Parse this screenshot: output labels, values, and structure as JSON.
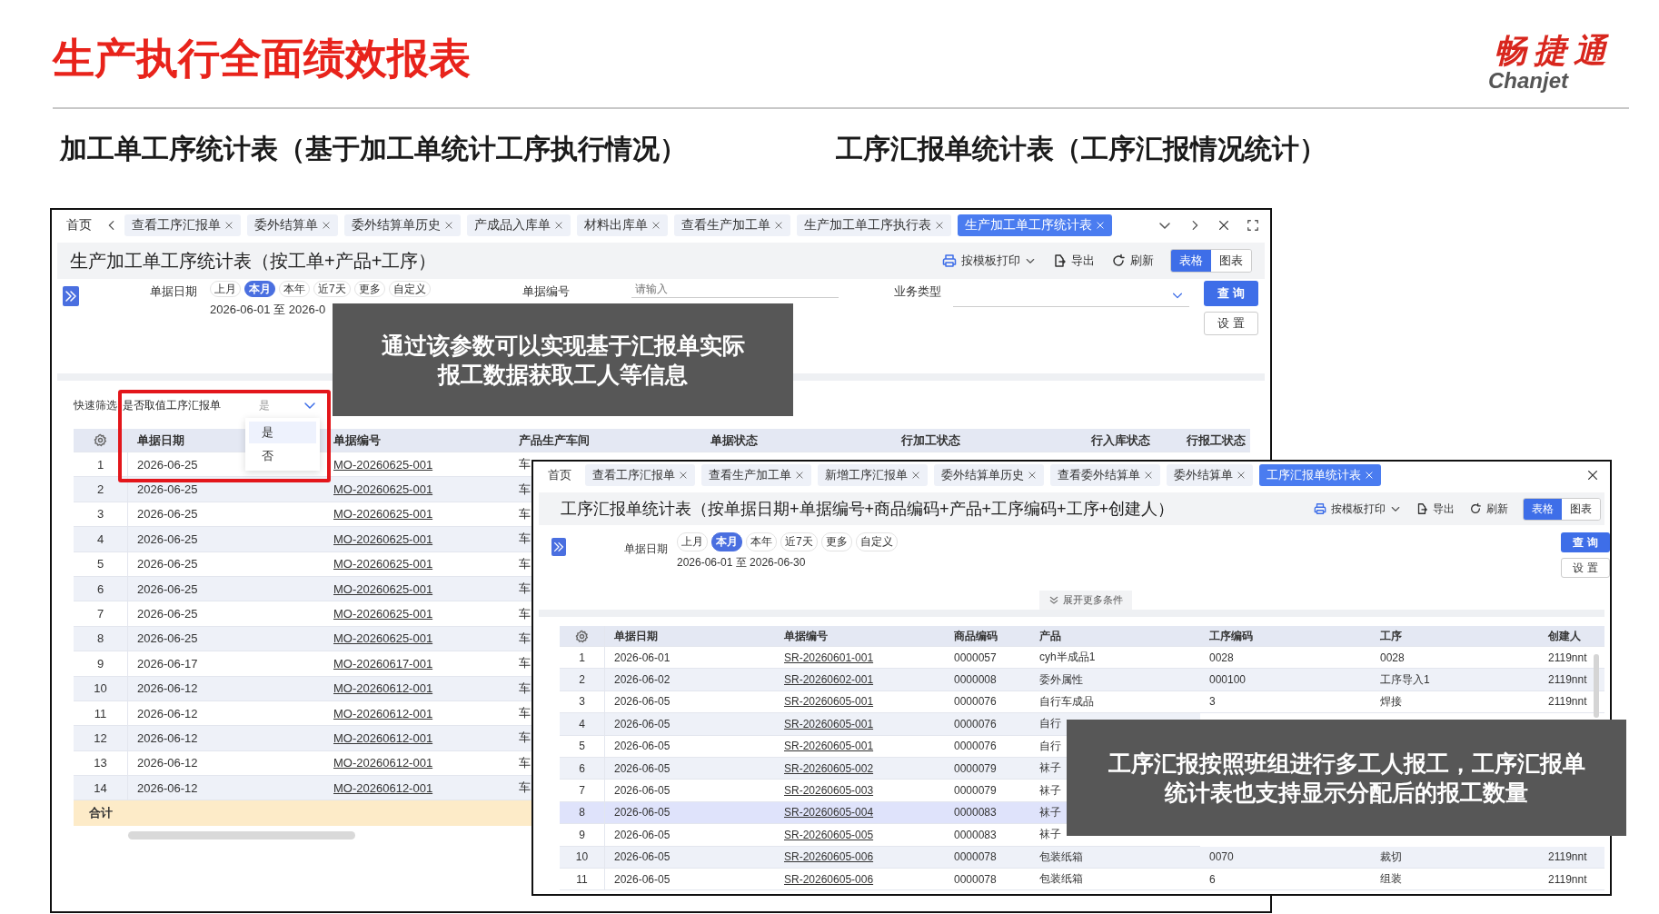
{
  "slide": {
    "title": "生产执行全面绩效报表",
    "logo": {
      "mark": "畅捷通",
      "wordmark": "Chanjet"
    }
  },
  "sections": [
    {
      "heading": "加工单工序统计表（基于加工单统计工序执行情况）"
    },
    {
      "heading": "工序汇报单统计表（工序汇报情况统计）"
    }
  ],
  "window_1": {
    "tabs": [
      {
        "label": "首页",
        "closable": false,
        "selected": false
      },
      {
        "label": "查看工序汇报单",
        "closable": true,
        "selected": false
      },
      {
        "label": "委外结算单",
        "closable": true,
        "selected": false
      },
      {
        "label": "委外结算单历史",
        "closable": true,
        "selected": false
      },
      {
        "label": "产成品入库单",
        "closable": true,
        "selected": false
      },
      {
        "label": "材料出库单",
        "closable": true,
        "selected": false
      },
      {
        "label": "查看生产加工单",
        "closable": true,
        "selected": false
      },
      {
        "label": "生产加工单工序执行表",
        "closable": true,
        "selected": false
      },
      {
        "label": "生产加工单工序统计表",
        "closable": true,
        "selected": true
      }
    ],
    "title": "生产加工单工序统计表（按工单+产品+工序）",
    "toolbar": {
      "print": "按模板打印",
      "export": "导出",
      "refresh": "刷新",
      "views": [
        {
          "label": "表格",
          "selected": true
        },
        {
          "label": "图表",
          "selected": false
        }
      ]
    },
    "filters": {
      "date_label": "单据日期",
      "presets": [
        {
          "label": "上月",
          "selected": false
        },
        {
          "label": "本月",
          "selected": true
        },
        {
          "label": "本年",
          "selected": false
        },
        {
          "label": "近7天",
          "selected": false
        },
        {
          "label": "更多",
          "selected": false
        },
        {
          "label": "自定义",
          "selected": false
        }
      ],
      "date_range": "2026-06-01 至 2026-0",
      "code_label": "单据编号",
      "code_placeholder": "请输入",
      "type_label": "业务类型",
      "query": "查 询",
      "settings": "设 置"
    },
    "quick_filter": {
      "label": "快速筛选",
      "field": "是否取值工序汇报单",
      "value": "是",
      "options": [
        {
          "label": "是",
          "selected": true
        },
        {
          "label": "否",
          "selected": false
        }
      ]
    },
    "columns": [
      {
        "label": "单据日期",
        "kind": "text"
      },
      {
        "label": "单据编号",
        "kind": "link"
      },
      {
        "label": "产品生产车间",
        "kind": "text"
      },
      {
        "label": "单据状态"
      },
      {
        "label": "行加工状态"
      },
      {
        "label": "行入库状态"
      },
      {
        "label": "行报工状态"
      }
    ],
    "rows": [
      {
        "seq": "1",
        "cells": [
          "2026-06-25",
          "MO-20260625-001",
          "车"
        ]
      },
      {
        "seq": "2",
        "cells": [
          "2026-06-25",
          "MO-20260625-001",
          "车"
        ]
      },
      {
        "seq": "3",
        "cells": [
          "2026-06-25",
          "MO-20260625-001",
          "车"
        ]
      },
      {
        "seq": "4",
        "cells": [
          "2026-06-25",
          "MO-20260625-001",
          "车"
        ]
      },
      {
        "seq": "5",
        "cells": [
          "2026-06-25",
          "MO-20260625-001",
          "车"
        ]
      },
      {
        "seq": "6",
        "cells": [
          "2026-06-25",
          "MO-20260625-001",
          "车"
        ]
      },
      {
        "seq": "7",
        "cells": [
          "2026-06-25",
          "MO-20260625-001",
          "车"
        ]
      },
      {
        "seq": "8",
        "cells": [
          "2026-06-25",
          "MO-20260625-001",
          "车"
        ]
      },
      {
        "seq": "9",
        "cells": [
          "2026-06-17",
          "MO-20260617-001",
          "车"
        ]
      },
      {
        "seq": "10",
        "cells": [
          "2026-06-12",
          "MO-20260612-001",
          "车"
        ]
      },
      {
        "seq": "11",
        "cells": [
          "2026-06-12",
          "MO-20260612-001",
          "车"
        ]
      },
      {
        "seq": "12",
        "cells": [
          "2026-06-12",
          "MO-20260612-001",
          "车"
        ]
      },
      {
        "seq": "13",
        "cells": [
          "2026-06-12",
          "MO-20260612-001",
          "车"
        ]
      },
      {
        "seq": "14",
        "cells": [
          "2026-06-12",
          "MO-20260612-001",
          "车"
        ]
      }
    ],
    "total_label": "合计"
  },
  "window_2": {
    "tabs": [
      {
        "label": "首页",
        "closable": false,
        "selected": false
      },
      {
        "label": "查看工序汇报单",
        "closable": true,
        "selected": false
      },
      {
        "label": "查看生产加工单",
        "closable": true,
        "selected": false
      },
      {
        "label": "新增工序汇报单",
        "closable": true,
        "selected": false
      },
      {
        "label": "委外结算单历史",
        "closable": true,
        "selected": false
      },
      {
        "label": "查看委外结算单",
        "closable": true,
        "selected": false
      },
      {
        "label": "委外结算单",
        "closable": true,
        "selected": false
      },
      {
        "label": "工序汇报单统计表",
        "closable": true,
        "selected": true
      }
    ],
    "title": "工序汇报单统计表（按单据日期+单据编号+商品编码+产品+工序编码+工序+创建人）",
    "toolbar": {
      "print": "按模板打印",
      "export": "导出",
      "refresh": "刷新",
      "views": [
        {
          "label": "表格",
          "selected": true
        },
        {
          "label": "图表",
          "selected": false
        }
      ]
    },
    "filters": {
      "date_label": "单据日期",
      "presets": [
        {
          "label": "上月",
          "selected": false
        },
        {
          "label": "本月",
          "selected": true
        },
        {
          "label": "本年",
          "selected": false
        },
        {
          "label": "近7天",
          "selected": false
        },
        {
          "label": "更多",
          "selected": false
        },
        {
          "label": "自定义",
          "selected": false
        }
      ],
      "date_range": "2026-06-01 至 2026-06-30",
      "query": "查 询",
      "settings": "设 置",
      "more": "展开更多条件"
    },
    "columns": [
      {
        "label": "单据日期",
        "kind": "text"
      },
      {
        "label": "单据编号",
        "kind": "link"
      },
      {
        "label": "商品编码",
        "kind": "text"
      },
      {
        "label": "产品",
        "kind": "text"
      },
      {
        "label": "工序编码",
        "kind": "text"
      },
      {
        "label": "工序",
        "kind": "text"
      },
      {
        "label": "创建人",
        "kind": "text"
      }
    ],
    "rows": [
      {
        "seq": "1",
        "cells": [
          "2026-06-01",
          "SR-20260601-001",
          "0000057",
          "cyh半成品1",
          "0028",
          "0028",
          "2119nnt"
        ],
        "selected": false
      },
      {
        "seq": "2",
        "cells": [
          "2026-06-02",
          "SR-20260602-001",
          "0000008",
          "委外属性",
          "000100",
          "工序导入1",
          "2119nnt"
        ],
        "selected": false
      },
      {
        "seq": "3",
        "cells": [
          "2026-06-05",
          "SR-20260605-001",
          "0000076",
          "自行车成品",
          "3",
          "焊接",
          "2119nnt"
        ],
        "selected": false
      },
      {
        "seq": "4",
        "cells": [
          "2026-06-05",
          "SR-20260605-001",
          "0000076",
          "自行"
        ],
        "selected": false
      },
      {
        "seq": "5",
        "cells": [
          "2026-06-05",
          "SR-20260605-001",
          "0000076",
          "自行"
        ],
        "selected": false
      },
      {
        "seq": "6",
        "cells": [
          "2026-06-05",
          "SR-20260605-002",
          "0000079",
          "袜子"
        ],
        "selected": false
      },
      {
        "seq": "7",
        "cells": [
          "2026-06-05",
          "SR-20260605-003",
          "0000079",
          "袜子"
        ],
        "selected": false
      },
      {
        "seq": "8",
        "cells": [
          "2026-06-05",
          "SR-20260605-004",
          "0000083",
          "袜子"
        ],
        "selected": true
      },
      {
        "seq": "9",
        "cells": [
          "2026-06-05",
          "SR-20260605-005",
          "0000083",
          "袜子"
        ],
        "selected": false
      },
      {
        "seq": "10",
        "cells": [
          "2026-06-05",
          "SR-20260605-006",
          "0000078",
          "包装纸箱",
          "0070",
          "裁切",
          "2119nnt"
        ],
        "selected": false
      },
      {
        "seq": "11",
        "cells": [
          "2026-06-05",
          "SR-20260605-006",
          "0000078",
          "包装纸箱",
          "6",
          "组装",
          "2119nnt"
        ],
        "selected": false
      }
    ]
  },
  "callouts": [
    {
      "text": "通过该参数可以实现基于汇报单实际报工数据获取工人等信息"
    },
    {
      "text": "工序汇报按照班组进行多工人报工，工序汇报单统计表也支持显示分配后的报工数量"
    }
  ]
}
